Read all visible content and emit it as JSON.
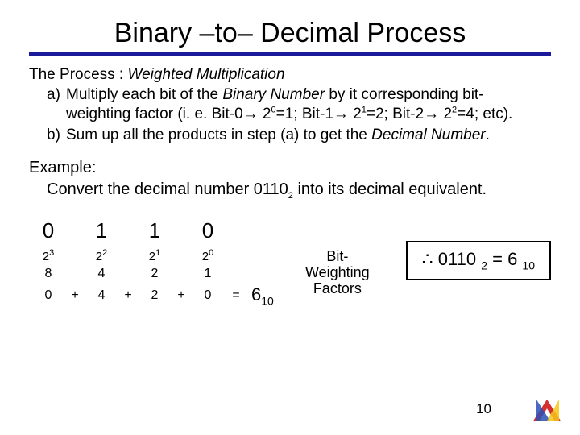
{
  "title": "Binary –to– Decimal Process",
  "process": {
    "label_plain": "The  Process : ",
    "label_em": "Weighted Multiplication",
    "a_marker": "a)",
    "a_line1_pre": "Multiply each bit of the ",
    "a_line1_binum": "Binary Number",
    "a_line1_post": " by it corresponding bit-",
    "a_line2": "weighting factor (i. e. Bit-0→ 2",
    "a_line2_b": "=1; Bit-1→ 2",
    "a_line2_c": "=2; Bit-2→ 2",
    "a_line2_d": "=4; etc).",
    "b_marker": "b)",
    "b_line_pre": "Sum up all the products in step (a) to get the ",
    "b_line_em": "Decimal Number",
    "b_line_post": "."
  },
  "example": {
    "label": "Example:",
    "question_pre": "Convert the decimal number 0110",
    "question_sub": "2",
    "question_post": " into its decimal equivalent."
  },
  "calc": {
    "bits": [
      "0",
      "1",
      "1",
      "0"
    ],
    "weight_bases": [
      "2",
      "2",
      "2",
      "2"
    ],
    "weight_exps": [
      "3",
      "2",
      "1",
      "0"
    ],
    "values": [
      "8",
      "4",
      "2",
      "1"
    ],
    "sum_terms": [
      "0",
      "4",
      "2",
      "0"
    ],
    "plus": "+",
    "equals": "=",
    "result_num": "6",
    "result_sub": "10"
  },
  "bw_label_line1": "Bit-Weighting",
  "bw_label_line2": "Factors",
  "result_box": {
    "therefore": "∴",
    "lhs_num": " 0110 ",
    "lhs_sub": "2",
    "middle": " =  6 ",
    "rhs_sub": "10"
  },
  "page_number": "10"
}
